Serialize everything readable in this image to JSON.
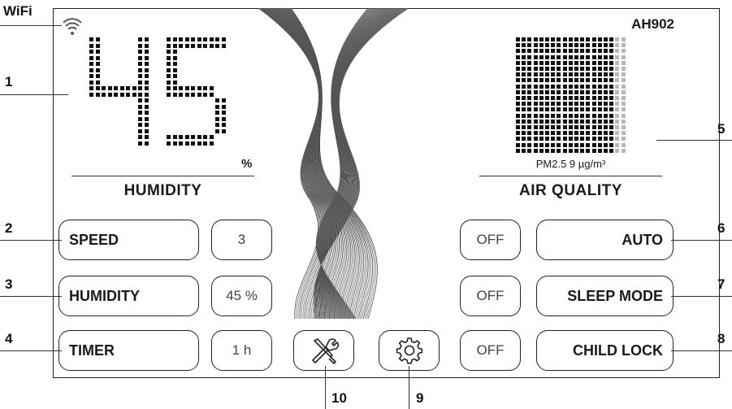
{
  "wifi": {
    "label": "WiFi",
    "icon": "wifi-icon"
  },
  "model": "AH902",
  "humidity_display": {
    "value": "45",
    "unit": "%",
    "title": "HUMIDITY"
  },
  "air_display": {
    "caption": "PM2.5 9 µg/m³",
    "title": "AIR QUALITY"
  },
  "left_controls": [
    {
      "label": "SPEED",
      "value": "3"
    },
    {
      "label": "HUMIDITY",
      "value": "45 %"
    },
    {
      "label": "TIMER",
      "value": "1 h"
    }
  ],
  "right_controls": [
    {
      "label": "AUTO",
      "value": "OFF"
    },
    {
      "label": "SLEEP MODE",
      "value": "OFF"
    },
    {
      "label": "CHILD LOCK",
      "value": "OFF"
    }
  ],
  "icons": {
    "tools": "tools-icon",
    "settings": "gear-icon"
  },
  "callouts": {
    "c1": "1",
    "c2": "2",
    "c3": "3",
    "c4": "4",
    "c5": "5",
    "c6": "6",
    "c7": "7",
    "c8": "8",
    "c9": "9",
    "c10": "10"
  }
}
